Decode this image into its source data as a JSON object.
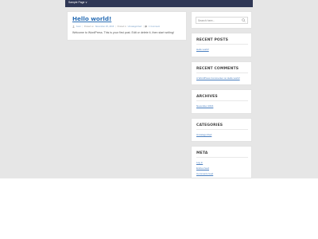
{
  "topnav": {
    "link": "Sample Page ∨"
  },
  "post": {
    "title": "Hello world!",
    "author": "Gust",
    "posted_label": "Posted on",
    "date": "November 25, 2016",
    "posted_in_label": "Posted in",
    "category": "Uncategorized",
    "comments": "1 Comment",
    "body": "Welcome to WordPress. This is your first post. Edit or delete it, then start writing!"
  },
  "search": {
    "placeholder": "Search here..."
  },
  "widgets": {
    "recent_posts": {
      "title": "RECENT POSTS",
      "items": [
        "Hello world!"
      ]
    },
    "recent_comments": {
      "title": "RECENT COMMENTS",
      "items": [
        "A WordPress Commenter on Hello world!"
      ]
    },
    "archives": {
      "title": "ARCHIVES",
      "items": [
        "November 2016"
      ]
    },
    "categories": {
      "title": "CATEGORIES",
      "items": [
        "Uncategorized"
      ]
    },
    "meta": {
      "title": "META",
      "items": [
        "Log in",
        "Entries feed",
        "Comments feed"
      ]
    }
  },
  "colors": {
    "nav_bg": "#2f3755",
    "link": "#2b6fb6",
    "page_bg": "#f1f1f1"
  }
}
